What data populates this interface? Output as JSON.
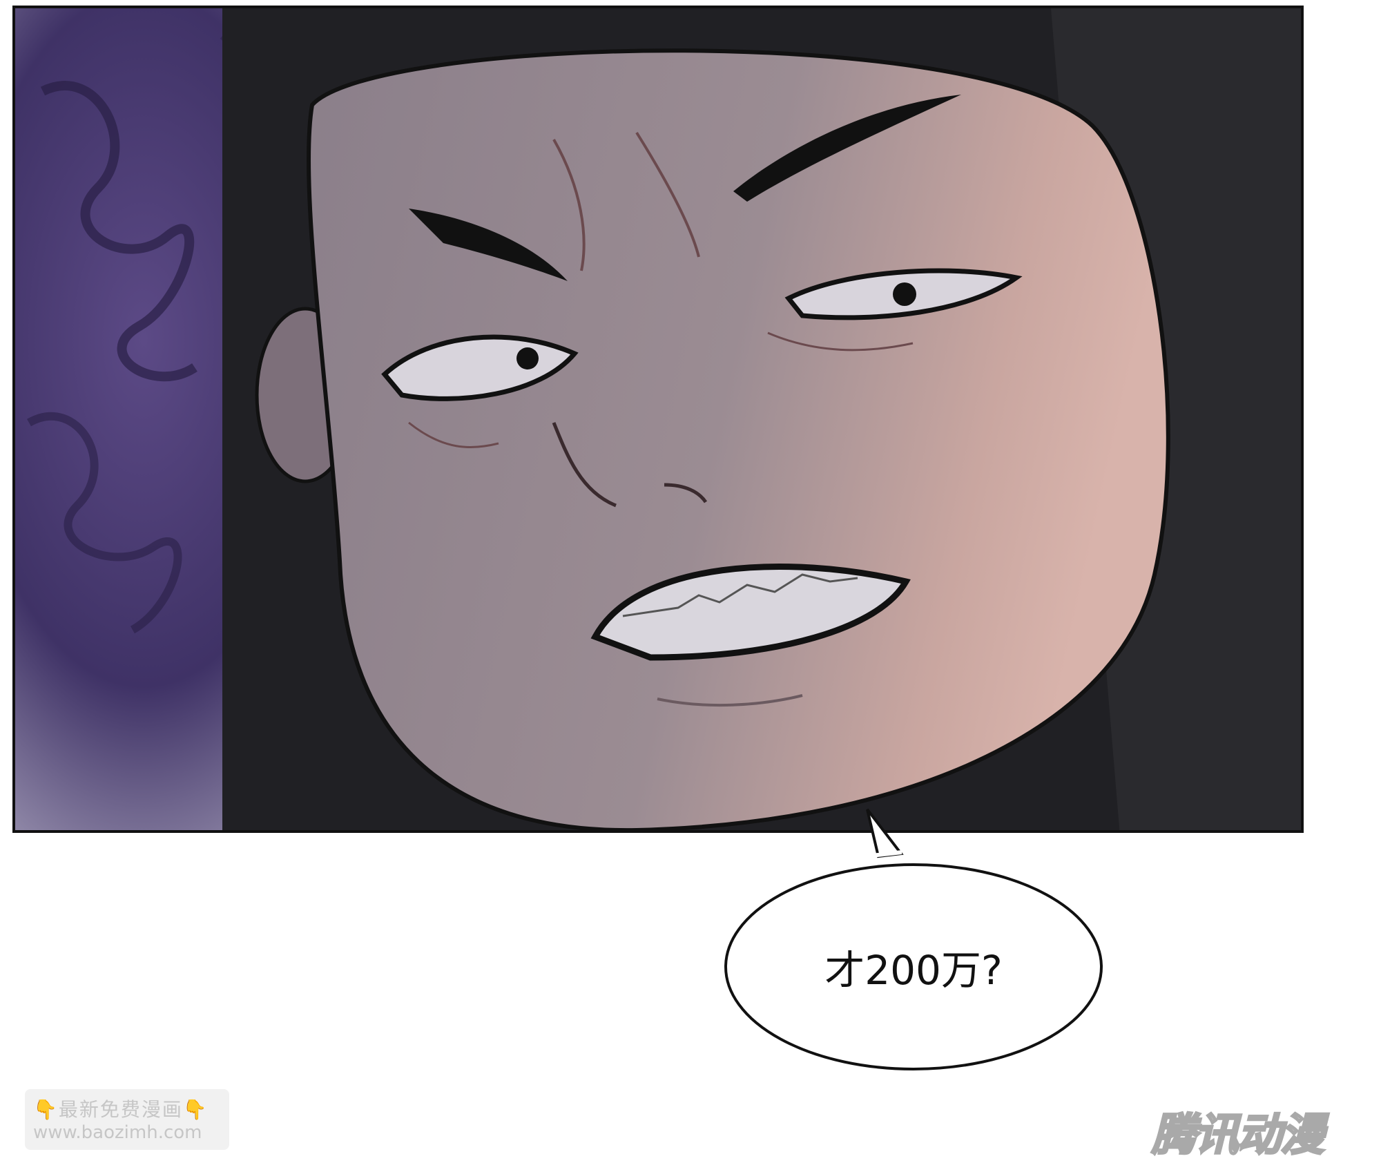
{
  "panel": {
    "speech_bubble": {
      "text": "才200万?"
    }
  },
  "watermarks": {
    "left": {
      "line1": "最新免费漫画",
      "line2": "www.baozimh.com",
      "hand_icon": "👇"
    },
    "right": {
      "text": "腾讯动漫"
    }
  }
}
